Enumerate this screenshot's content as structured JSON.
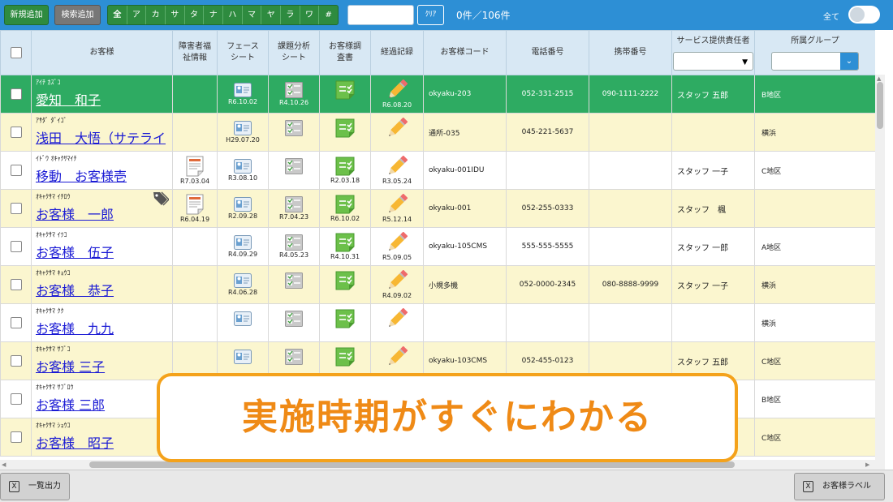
{
  "toolbar": {
    "new_label": "新規追加",
    "search_add_label": "検索追加",
    "kana": [
      "全",
      "ア",
      "カ",
      "サ",
      "タ",
      "ナ",
      "ハ",
      "マ",
      "ヤ",
      "ラ",
      "ワ",
      "#"
    ],
    "search_value": "",
    "clear_label": "ｸﾘｱ",
    "count": "0件／106件",
    "all_label": "全て",
    "toggle_on": false
  },
  "table": {
    "headers": [
      "お客様",
      "障害者福祉情報",
      "フェースシート",
      "課題分析シート",
      "お客様調査書",
      "経過記録",
      "お客様コード",
      "電話番号",
      "携帯番号",
      "サービス提供責任者",
      "所属グループ"
    ],
    "header_lines": {
      "disability": [
        "障害者福",
        "祉情報"
      ],
      "face": [
        "フェース",
        "シート"
      ],
      "issue": [
        "課題分析",
        "シート"
      ],
      "survey": [
        "お客様調",
        "査書"
      ]
    },
    "rows": [
      {
        "kana": "ｱｲﾁ ｶｽﾞｺ",
        "name": "愛知　和子",
        "dis": "",
        "face": "R6.10.02",
        "issue": "R4.10.26",
        "survey": "",
        "rec": "R6.08.20",
        "code": "okyaku-203",
        "tel": "052-331-2515",
        "mobile": "090-1111-2222",
        "staff": "スタッフ 五郎",
        "group": "B地区",
        "style": "sel",
        "has_dis": false,
        "has_survey": true
      },
      {
        "kana": "ｱｻﾀﾞ ﾀﾞｲｺﾞ",
        "name": "浅田　大悟（サテライ",
        "dis": "",
        "face": "H29.07.20",
        "issue": "",
        "survey": "",
        "rec": "",
        "code": "通所-035",
        "tel": "045-221-5637",
        "mobile": "",
        "staff": "",
        "group": "横浜",
        "style": "ylw",
        "has_dis": false,
        "has_survey": true
      },
      {
        "kana": "ｲﾄﾞｳ ｵｷｬｸｻﾏｲﾁ",
        "name": "移動　お客様壱",
        "dis": "R7.03.04",
        "face": "R3.08.10",
        "issue": "",
        "survey": "R2.03.18",
        "rec": "R3.05.24",
        "code": "okyaku-001IDU",
        "tel": "",
        "mobile": "",
        "staff": "スタッフ 一子",
        "group": "C地区",
        "style": "wht",
        "has_dis": true,
        "has_survey": true
      },
      {
        "kana": "ｵｷｬｸｻﾏ ｲﾁﾛｳ",
        "name": "お客様　一郎",
        "dis": "R6.04.19",
        "face": "R2.09.28",
        "issue": "R7.04.23",
        "survey": "R6.10.02",
        "rec": "R5.12.14",
        "code": "okyaku-001",
        "tel": "052-255-0333",
        "mobile": "",
        "staff": "スタッフ　楓",
        "group": "",
        "style": "ylw",
        "has_dis": true,
        "has_survey": true,
        "tag": true
      },
      {
        "kana": "ｵｷｬｸｻﾏ ｲﾂｺ",
        "name": "お客様　伍子",
        "dis": "",
        "face": "R4.09.29",
        "issue": "R4.05.23",
        "survey": "R4.10.31",
        "rec": "R5.09.05",
        "code": "okyaku-105CMS",
        "tel": "555-555-5555",
        "mobile": "",
        "staff": "スタッフ 一郎",
        "group": "A地区",
        "style": "wht",
        "has_dis": false,
        "has_survey": true
      },
      {
        "kana": "ｵｷｬｸｻﾏ ｷｮｳｺ",
        "name": "お客様　恭子",
        "dis": "",
        "face": "R4.06.28",
        "issue": "",
        "survey": "",
        "rec": "R4.09.02",
        "code": "小規多機",
        "tel": "052-0000-2345",
        "mobile": "080-8888-9999",
        "staff": "スタッフ 一子",
        "group": "横浜",
        "style": "ylw",
        "has_dis": false,
        "has_survey": true
      },
      {
        "kana": "ｵｷｬｸｻﾏ ｸｸ",
        "name": "お客様　九九",
        "dis": "",
        "face": "",
        "issue": "",
        "survey": "",
        "rec": "",
        "code": "",
        "tel": "",
        "mobile": "",
        "staff": "",
        "group": "横浜",
        "style": "wht",
        "has_dis": false,
        "has_survey": true
      },
      {
        "kana": "ｵｷｬｸｻﾏ ｻﾌﾞｺ",
        "name": "お客様 三子",
        "dis": "",
        "face": "",
        "issue": "",
        "survey": "",
        "rec": "",
        "code": "okyaku-103CMS",
        "tel": "052-455-0123",
        "mobile": "",
        "staff": "スタッフ 五郎",
        "group": "C地区",
        "style": "ylw",
        "has_dis": false,
        "has_survey": true
      },
      {
        "kana": "ｵｷｬｸｻﾏ ｻﾌﾞﾛｳ",
        "name": "お客様 三郎",
        "dis": "",
        "face": "",
        "issue": "",
        "survey": "",
        "rec": "",
        "code": "",
        "tel": "",
        "mobile": "",
        "staff": "",
        "group": "B地区",
        "style": "wht",
        "has_dis": false,
        "has_survey": false
      },
      {
        "kana": "ｵｷｬｸｻﾏ ｼｮｳｺ",
        "name": "お客様　昭子",
        "dis": "",
        "face": "",
        "issue": "",
        "survey": "",
        "rec": "",
        "code": "",
        "tel": "",
        "mobile": "",
        "staff": "",
        "group": "C地区",
        "style": "ylw",
        "has_dis": false,
        "has_survey": false
      }
    ]
  },
  "footer": {
    "export_label": "一覧出力",
    "label_button": "お客様ラベル"
  },
  "callout": {
    "text": "実施時期がすぐにわかる"
  },
  "colors": {
    "toolbar": "#2d8fd5",
    "selected_row": "#2eab62",
    "alt_row": "#fbf6cf",
    "callout_border": "#f4a21b",
    "callout_text": "#ef8a16"
  }
}
